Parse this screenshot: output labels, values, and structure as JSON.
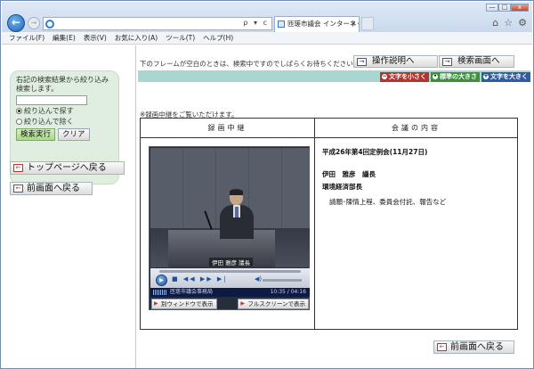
{
  "browser": {
    "address_tools": "ρ ▾ c",
    "tab_title": "匝瑳市議会 インターネッ...",
    "tab_close": "×",
    "menu": [
      "ファイル(F)",
      "編集(E)",
      "表示(V)",
      "お気に入り(A)",
      "ツール(T)",
      "ヘルプ(H)"
    ],
    "window_buttons": [
      "—",
      "□",
      "x"
    ],
    "icons": [
      "home-icon",
      "star-icon",
      "gear-icon"
    ]
  },
  "left": {
    "search_desc": "右記の検索結果から絞り込み検索します。",
    "keyword_value": "",
    "radio_narrow": "絞り込んで探す",
    "radio_exclude": "絞り込んで除く",
    "search_button": "検索実行",
    "clear_button": "クリア",
    "top_page_button": "トップページへ戻る",
    "prev_page_button": "前画面へ戻る"
  },
  "main": {
    "notice": "下のフレームが空白のときは、検索中ですのでしばらくお待ちください。",
    "help_button": "操作説明へ",
    "search_screen_button": "検索画面へ",
    "font_small": "文字を小さく",
    "font_standard": "標準の大きさ",
    "font_large": "文字を大きく",
    "relay_note": "※録画中継をご覧いただけます。",
    "table_header_left": "録画中継",
    "table_header_right": "会議の内容",
    "video_caption": "伊田 雅彦 議長",
    "player_org": "匝瑳市議会事務局",
    "player_time": "10:35 / 04:16",
    "player_controls": "■ ◀◀ ▶▶ ▶|",
    "player_volume": "◀)",
    "play_symbol": "▶",
    "new_window_button": "別ウィンドウで表示",
    "fullscreen_button": "フルスクリーンで表示",
    "meeting_title": "平成26年第4回定例会(11月27日)",
    "speaker_name": "伊田　雅彦　議長",
    "speaker_role": "環境経済部長",
    "agenda": "請願･陳情上程、委員会付託、報告など",
    "back_button": "前画面へ戻る"
  },
  "colors": {
    "teal_bar": "#a9d6cf",
    "search_panel": "#dfeede",
    "font_small_bg": "#b6332e",
    "font_standard_bg": "#3f8f3f",
    "font_large_bg": "#2f5ca8"
  }
}
